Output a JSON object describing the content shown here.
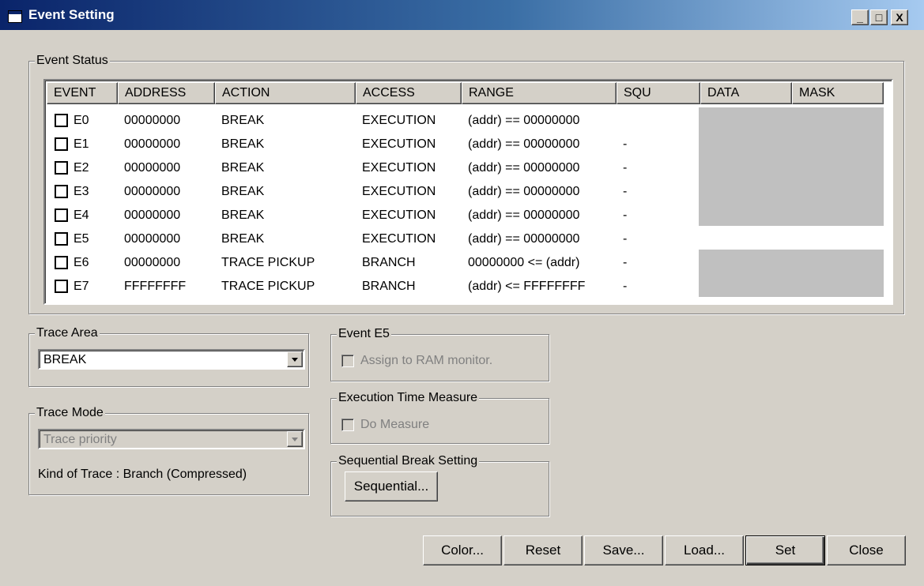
{
  "window": {
    "title": "Event Setting",
    "controls": {
      "minimize": "_",
      "maximize": "□",
      "close": "X"
    }
  },
  "event_status": {
    "label": "Event Status",
    "columns": [
      "EVENT",
      "ADDRESS",
      "ACTION",
      "ACCESS",
      "RANGE",
      "SQU",
      "DATA",
      "MASK"
    ],
    "rows": [
      {
        "event": "E0",
        "address": "00000000",
        "action": "BREAK",
        "access": "EXECUTION",
        "range": "(addr) == 00000000",
        "squ": ""
      },
      {
        "event": "E1",
        "address": "00000000",
        "action": "BREAK",
        "access": "EXECUTION",
        "range": "(addr) == 00000000",
        "squ": "-"
      },
      {
        "event": "E2",
        "address": "00000000",
        "action": "BREAK",
        "access": "EXECUTION",
        "range": "(addr) == 00000000",
        "squ": "-"
      },
      {
        "event": "E3",
        "address": "00000000",
        "action": "BREAK",
        "access": "EXECUTION",
        "range": "(addr) == 00000000",
        "squ": "-"
      },
      {
        "event": "E4",
        "address": "00000000",
        "action": "BREAK",
        "access": "EXECUTION",
        "range": "(addr) == 00000000",
        "squ": "-"
      },
      {
        "event": "E5",
        "address": "00000000",
        "action": "BREAK",
        "access": "EXECUTION",
        "range": "(addr) == 00000000",
        "squ": "-"
      },
      {
        "event": "E6",
        "address": "00000000",
        "action": "TRACE PICKUP",
        "access": "BRANCH",
        "range": "00000000 <= (addr)",
        "squ": "-"
      },
      {
        "event": "E7",
        "address": "FFFFFFFF",
        "action": "TRACE PICKUP",
        "access": "BRANCH",
        "range": "(addr) <= FFFFFFFF",
        "squ": "-"
      }
    ]
  },
  "trace_area": {
    "label": "Trace Area",
    "value": "BREAK"
  },
  "trace_mode": {
    "label": "Trace Mode",
    "value": "Trace priority",
    "kind": "Kind of Trace : Branch (Compressed)"
  },
  "event_e5": {
    "label": "Event E5",
    "checkbox": "Assign to RAM monitor."
  },
  "exec_time": {
    "label": "Execution Time Measure",
    "checkbox": "Do Measure"
  },
  "sequential": {
    "label": "Sequential Break Setting",
    "button": "Sequential..."
  },
  "buttons": {
    "color": "Color...",
    "reset": "Reset",
    "save": "Save...",
    "load": "Load...",
    "set": "Set",
    "close": "Close"
  }
}
